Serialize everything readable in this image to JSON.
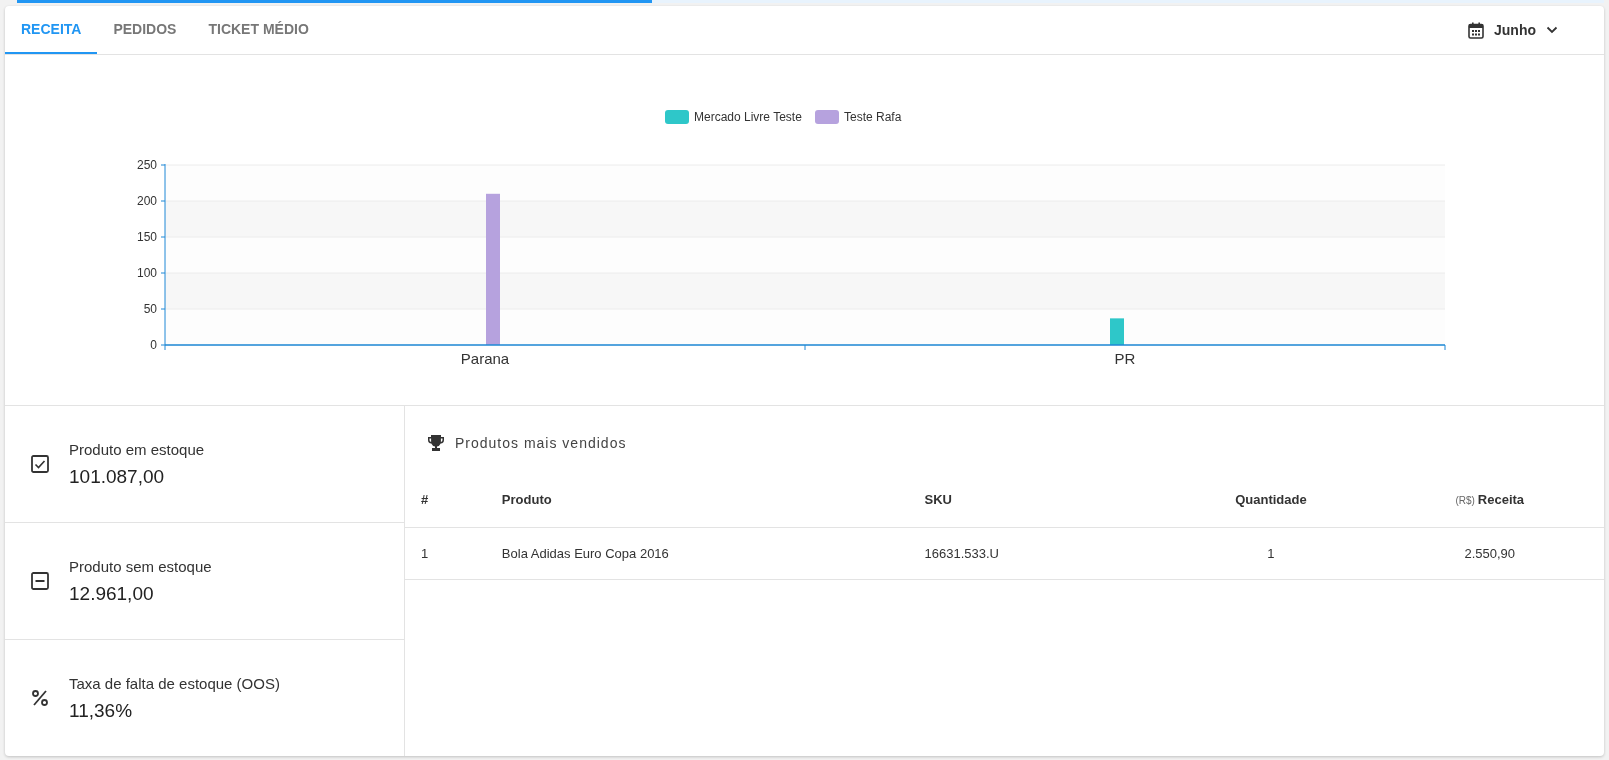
{
  "loading_bar": {
    "level": 0.4
  },
  "tabs": [
    {
      "label": "RECEITA",
      "selected": true
    },
    {
      "label": "PEDIDOS",
      "selected": false
    },
    {
      "label": "TICKET MÉDIO",
      "selected": false
    }
  ],
  "month_selector": {
    "value": "Junho"
  },
  "chart": {
    "chart_data": {
      "type": "bar",
      "categories": [
        "Parana",
        "PR"
      ],
      "series": [
        {
          "name": "Mercado Livre Teste",
          "color": "#2ec7c9",
          "values": [
            0,
            37
          ]
        },
        {
          "name": "Teste Rafa",
          "color": "#b6a2de",
          "values": [
            210,
            0
          ]
        }
      ],
      "grid": true,
      "legend": true,
      "ylim": [
        0,
        250
      ],
      "yticks": [
        0,
        50,
        100,
        150,
        200,
        250
      ]
    }
  },
  "stats": [
    {
      "kind": "check",
      "title": "Produto em estoque",
      "value": "101.087,00"
    },
    {
      "kind": "minus",
      "title": "Produto sem estoque",
      "value": "12.961,00"
    },
    {
      "kind": "percent",
      "title": "Taxa de falta de estoque (OOS)",
      "value": "11,36%"
    }
  ],
  "best_sellers": {
    "title": "Produtos mais vendidos",
    "columns": [
      {
        "label": "#"
      },
      {
        "label": "Produto"
      },
      {
        "label": "SKU"
      },
      {
        "label": "Quantidade"
      },
      {
        "prefix": "(R$)",
        "label": "Receita"
      }
    ],
    "rows": [
      [
        "1",
        "Bola Adidas Euro Copa 2016",
        "16631.533.U",
        "1",
        "2.550,90"
      ]
    ]
  }
}
